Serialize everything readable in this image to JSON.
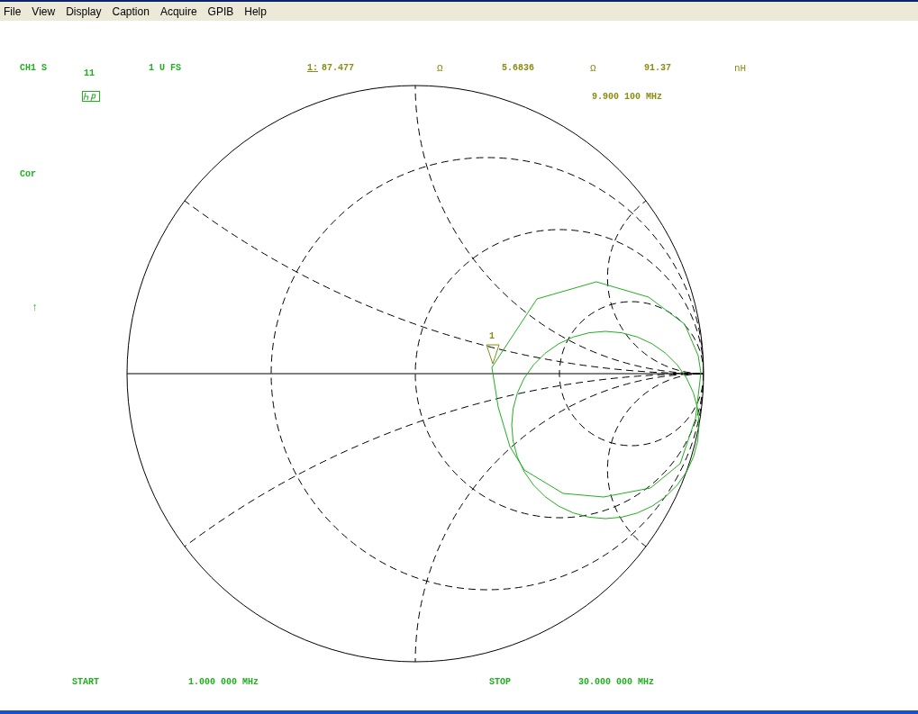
{
  "menu": [
    "File",
    "View",
    "Display",
    "Caption",
    "Acquire",
    "GPIB",
    "Help"
  ],
  "display": {
    "channel": "CH1 S",
    "parameter_index": "11",
    "scale": "1 U FS",
    "marker_label": "1:",
    "readings": [
      {
        "kind": "value",
        "text": "87.477"
      },
      {
        "kind": "unit",
        "text": "Ω"
      },
      {
        "kind": "value",
        "text": "5.6836"
      },
      {
        "kind": "unit",
        "text": "Ω"
      },
      {
        "kind": "value",
        "text": "91.37"
      },
      {
        "kind": "unit",
        "text": "nH"
      }
    ],
    "marker_frequency": "9.900 100 MHz",
    "correction": "Cor",
    "arrow": "↑",
    "marker_number": "1",
    "start_label": "START",
    "start_value": "1.000 000 MHz",
    "stop_label": "STOP",
    "stop_value": "30.000 000 MHz"
  }
}
